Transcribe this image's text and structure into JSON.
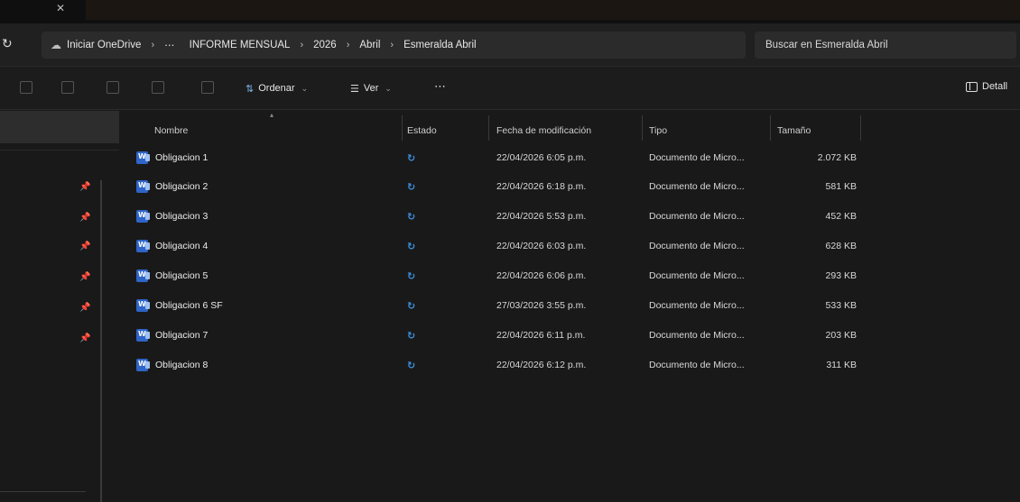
{
  "addressbar": {
    "breadcrumb": [
      "Iniciar OneDrive",
      "⋯",
      "INFORME MENSUAL",
      "2026",
      "Abril",
      "Esmeralda Abril"
    ],
    "search_placeholder": "Buscar en Esmeralda Abril"
  },
  "toolbar": {
    "sort_label": "Ordenar",
    "view_label": "Ver",
    "more_label": "⋯",
    "details_label": "Detall"
  },
  "columns": {
    "name": "Nombre",
    "state": "Estado",
    "modified": "Fecha de modificación",
    "type": "Tipo",
    "size": "Tamaño"
  },
  "files": [
    {
      "name": "Obligacion 1",
      "modified": "22/04/2026 6:05 p.m.",
      "type": "Documento de Micro...",
      "size": "2.072 KB"
    },
    {
      "name": "Obligacion 2",
      "modified": "22/04/2026 6:18 p.m.",
      "type": "Documento de Micro...",
      "size": "581 KB"
    },
    {
      "name": "Obligacion 3",
      "modified": "22/04/2026 5:53 p.m.",
      "type": "Documento de Micro...",
      "size": "452 KB"
    },
    {
      "name": "Obligacion 4",
      "modified": "22/04/2026 6:03 p.m.",
      "type": "Documento de Micro...",
      "size": "628 KB"
    },
    {
      "name": "Obligacion 5",
      "modified": "22/04/2026 6:06 p.m.",
      "type": "Documento de Micro...",
      "size": "293 KB"
    },
    {
      "name": "Obligacion 6 SF",
      "modified": "27/03/2026 3:55 p.m.",
      "type": "Documento de Micro...",
      "size": "533 KB"
    },
    {
      "name": "Obligacion 7",
      "modified": "22/04/2026 6:11 p.m.",
      "type": "Documento de Micro...",
      "size": "203 KB"
    },
    {
      "name": "Obligacion 8",
      "modified": "22/04/2026 6:12 p.m.",
      "type": "Documento de Micro...",
      "size": "311 KB"
    }
  ],
  "colors": {
    "accent": "#3c8fdc",
    "word_icon": "#2f64c8",
    "background": "#191919"
  }
}
